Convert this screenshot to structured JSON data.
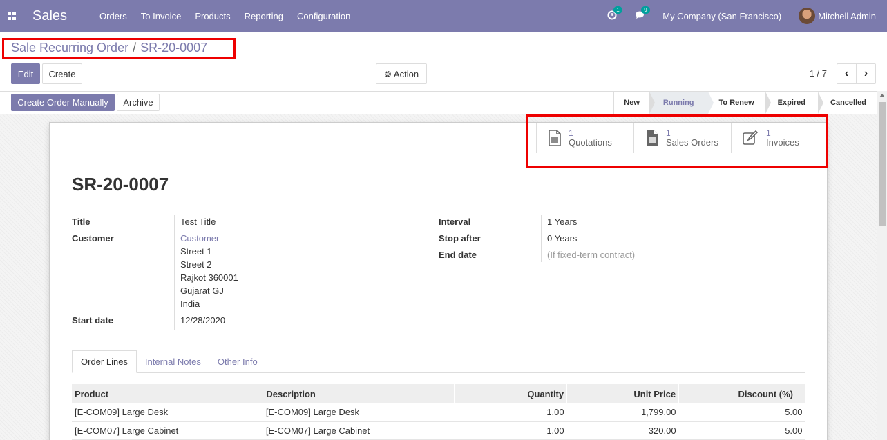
{
  "navbar": {
    "app_name": "Sales",
    "menu": [
      "Orders",
      "To Invoice",
      "Products",
      "Reporting",
      "Configuration"
    ],
    "activity_count": "1",
    "message_count": "9",
    "company": "My Company (San Francisco)",
    "user": "Mitchell Admin"
  },
  "breadcrumb": {
    "parent": "Sale Recurring Order",
    "separator": "/",
    "current": "SR-20-0007"
  },
  "buttons": {
    "edit": "Edit",
    "create": "Create",
    "action": "Action",
    "create_order_manually": "Create Order Manually",
    "archive": "Archive"
  },
  "pager": {
    "value": "1 / 7"
  },
  "stages": [
    {
      "label": "New"
    },
    {
      "label": "Running"
    },
    {
      "label": "To Renew"
    },
    {
      "label": "Expired"
    },
    {
      "label": "Cancelled"
    }
  ],
  "smart_buttons": [
    {
      "count": "1",
      "label": "Quotations",
      "icon": "file-text-icon"
    },
    {
      "count": "1",
      "label": "Sales Orders",
      "icon": "file-icon"
    },
    {
      "count": "1",
      "label": "Invoices",
      "icon": "edit-icon"
    }
  ],
  "record": {
    "name": "SR-20-0007",
    "left": {
      "title_label": "Title",
      "title_value": "Test Title",
      "customer_label": "Customer",
      "customer_name": "Customer",
      "address": [
        "Street 1",
        "Street 2",
        "Rajkot 360001",
        "Gujarat GJ",
        "India"
      ],
      "start_date_label": "Start date",
      "start_date_value": "12/28/2020"
    },
    "right": {
      "interval_label": "Interval",
      "interval_value": "1",
      "interval_unit": "Years",
      "stop_after_label": "Stop after",
      "stop_after_value": "0",
      "stop_after_unit": "Years",
      "end_date_label": "End date",
      "end_date_placeholder": "(If fixed-term contract)"
    }
  },
  "tabs": [
    "Order Lines",
    "Internal Notes",
    "Other Info"
  ],
  "order_lines": {
    "headers": [
      "Product",
      "Description",
      "Quantity",
      "Unit Price",
      "Discount (%)"
    ],
    "rows": [
      [
        "[E-COM09] Large Desk",
        "[E-COM09] Large Desk",
        "1.00",
        "1,799.00",
        "5.00"
      ],
      [
        "[E-COM07] Large Cabinet",
        "[E-COM07] Large Cabinet",
        "1.00",
        "320.00",
        "5.00"
      ]
    ]
  }
}
